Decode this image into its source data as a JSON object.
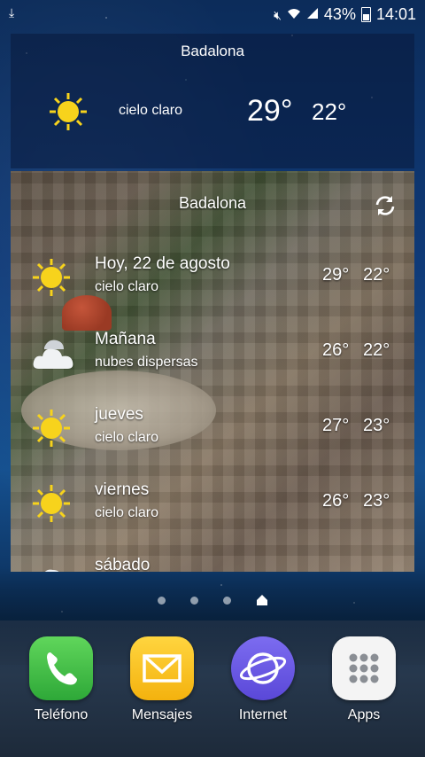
{
  "status_bar": {
    "battery_percent": "43%",
    "time": "14:01",
    "icons": [
      "download-icon",
      "mute-icon",
      "wifi-icon",
      "signal-icon",
      "battery-icon"
    ]
  },
  "widget_small": {
    "city": "Badalona",
    "icon": "sun-icon",
    "description": "cielo claro",
    "high": "29°",
    "low": "22°"
  },
  "widget_forecast": {
    "city": "Badalona",
    "refresh_icon": "refresh-icon",
    "days": [
      {
        "name": "Hoy, 22 de agosto",
        "description": "cielo claro",
        "high": "29°",
        "low": "22°",
        "icon": "sun-icon"
      },
      {
        "name": "Mañana",
        "description": "nubes dispersas",
        "high": "26°",
        "low": "22°",
        "icon": "cloud-icon"
      },
      {
        "name": "jueves",
        "description": "cielo claro",
        "high": "27°",
        "low": "23°",
        "icon": "sun-icon"
      },
      {
        "name": "viernes",
        "description": "cielo claro",
        "high": "26°",
        "low": "23°",
        "icon": "sun-icon"
      },
      {
        "name": "sábado",
        "description": "",
        "high": "",
        "low": "",
        "icon": "cloud-icon"
      }
    ]
  },
  "dock": {
    "apps": [
      {
        "label": "Teléfono",
        "icon": "phone-icon"
      },
      {
        "label": "Mensajes",
        "icon": "envelope-icon"
      },
      {
        "label": "Internet",
        "icon": "internet-icon"
      },
      {
        "label": "Apps",
        "icon": "apps-grid-icon"
      }
    ]
  }
}
